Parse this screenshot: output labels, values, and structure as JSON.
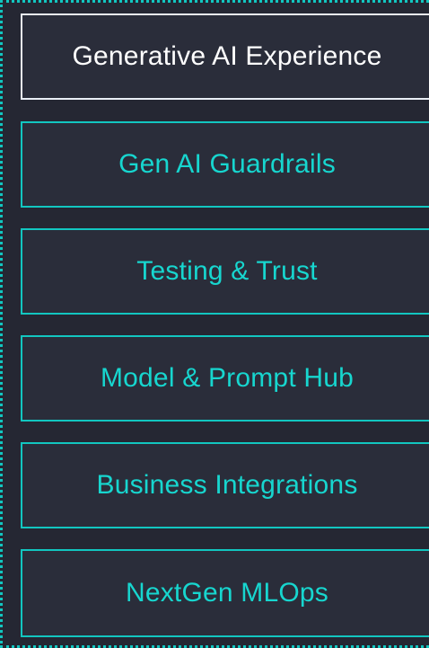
{
  "menu": {
    "active_index": 0,
    "items": [
      {
        "label": "Generative AI Experience"
      },
      {
        "label": "Gen AI Guardrails"
      },
      {
        "label": "Testing & Trust"
      },
      {
        "label": "Model & Prompt Hub"
      },
      {
        "label": "Business Integrations"
      },
      {
        "label": "NextGen MLOps"
      }
    ]
  },
  "colors": {
    "accent": "#12c6c0",
    "text_accent": "#17d6cf",
    "background": "#252733",
    "item_background": "#2a2d3a",
    "active_text": "#ffffff"
  }
}
